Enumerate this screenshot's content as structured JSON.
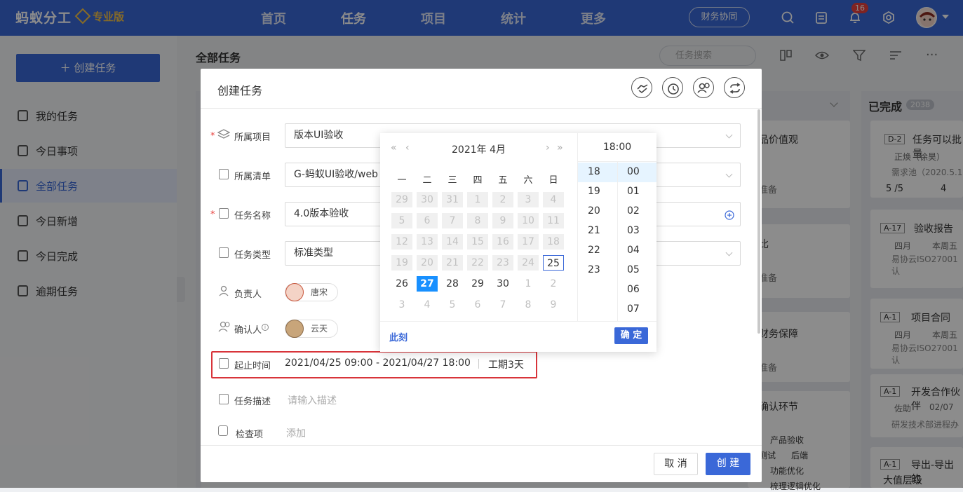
{
  "header": {
    "brand": "蚂蚁分工",
    "edition": "专业版",
    "nav": [
      "首页",
      "任务",
      "项目",
      "统计",
      "更多"
    ],
    "active_nav": "任务",
    "finance_button": "财务协同",
    "notification_count": "16"
  },
  "sidebar": {
    "create_button": "＋ 创建任务",
    "items": [
      {
        "label": "我的任务"
      },
      {
        "label": "今日事项"
      },
      {
        "label": "全部任务"
      },
      {
        "label": "今日新增"
      },
      {
        "label": "今日完成"
      },
      {
        "label": "逾期任务"
      }
    ]
  },
  "main": {
    "title": "全部任务",
    "search_placeholder": "任务搜索",
    "done_column": {
      "title": "已完成",
      "count": "2038"
    },
    "background_texts": [
      "品价值观",
      "准备",
      "比",
      "准备",
      "财务保障",
      "准备",
      "确认环节",
      "产品验收",
      "测试",
      "后端",
      "功能优化",
      "梳理逻辑优化"
    ],
    "done_cards": [
      {
        "tag": "D-2",
        "title": "任务可以批量",
        "user": "正焕（徐昊）",
        "project": "需求池（2020.5.1",
        "stats": "5 /5",
        "comments": "4"
      },
      {
        "tag": "A-17",
        "title": "验收报告",
        "user": "四月",
        "due": "本周五",
        "project": "易协云ISO27001认"
      },
      {
        "tag": "A-1",
        "title": "项目合同",
        "user": "四月",
        "due": "本周五",
        "project": "易协云ISO27001认"
      },
      {
        "tag": "A-1",
        "title": "开发合作伙伴",
        "user": "佐助",
        "due": "02/07",
        "project": "研发技术部进程办"
      },
      {
        "tag": "A-1",
        "title": "导出-导出的",
        "extra": "大值层级"
      }
    ]
  },
  "modal": {
    "title": "创建任务",
    "fields": {
      "project": {
        "label": "所属项目",
        "value": "版本UI验收"
      },
      "list": {
        "label": "所属清单",
        "value": "G-蚂蚁UI验收/web"
      },
      "name": {
        "label": "任务名称",
        "value": "4.0版本验收"
      },
      "type": {
        "label": "任务类型",
        "value": "标准类型"
      },
      "owner": {
        "label": "负责人",
        "value": "唐宋"
      },
      "confirmer": {
        "label": "确认人",
        "value": "云天"
      },
      "time": {
        "label": "起止时间",
        "range": "2021/04/25 09:00 - 2021/04/27 18:00",
        "duration": "工期3天"
      },
      "desc": {
        "label": "任务描述",
        "placeholder": "请输入描述"
      },
      "check": {
        "label": "检查项",
        "placeholder": "添加"
      }
    },
    "cancel": "取 消",
    "create": "创 建"
  },
  "picker": {
    "title": "2021年  4月",
    "time_title": "18:00",
    "weekdays": [
      "一",
      "二",
      "三",
      "四",
      "五",
      "六",
      "日"
    ],
    "days": [
      [
        "29",
        "30",
        "31",
        "1",
        "2",
        "3",
        "4"
      ],
      [
        "5",
        "6",
        "7",
        "8",
        "9",
        "10",
        "11"
      ],
      [
        "12",
        "13",
        "14",
        "15",
        "16",
        "17",
        "18"
      ],
      [
        "19",
        "20",
        "21",
        "22",
        "23",
        "24",
        "25"
      ],
      [
        "26",
        "27",
        "28",
        "29",
        "30",
        "1",
        "2"
      ],
      [
        "3",
        "4",
        "5",
        "6",
        "7",
        "8",
        "9"
      ]
    ],
    "hours": [
      "18",
      "19",
      "20",
      "21",
      "22",
      "23"
    ],
    "minutes": [
      "00",
      "01",
      "02",
      "03",
      "04",
      "05",
      "06",
      "07"
    ],
    "now": "此刻",
    "confirm": "确 定"
  }
}
